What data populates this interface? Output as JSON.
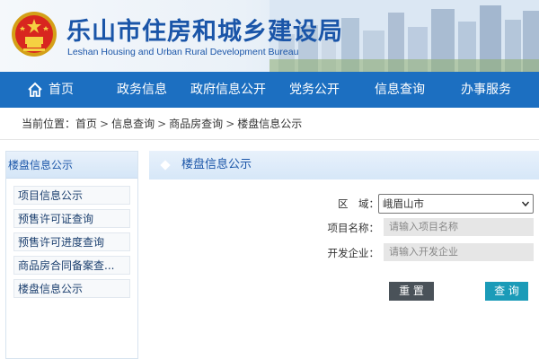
{
  "header": {
    "title": "乐山市住房和城乡建设局",
    "subtitle": "Leshan Housing and Urban Rural Development Bureau",
    "emblem_icon": "national-emblem-icon"
  },
  "nav": {
    "home": "首页",
    "items": [
      "政务信息",
      "政府信息公开",
      "党务公开",
      "信息查询",
      "办事服务"
    ]
  },
  "breadcrumb": {
    "label": "当前位置：",
    "items": [
      "首页",
      "信息查询",
      "商品房查询",
      "楼盘信息公示"
    ],
    "separator": ">"
  },
  "sidebar": {
    "title": "楼盘信息公示",
    "items": [
      "项目信息公示",
      "预售许可证查询",
      "预售许可进度查询",
      "商品房合同备案查...",
      "楼盘信息公示"
    ]
  },
  "panel": {
    "title": "楼盘信息公示",
    "form": {
      "region_label": "区　域：",
      "region_value": "峨眉山市",
      "project_label": "项目名称：",
      "project_placeholder": "请输入项目名称",
      "developer_label": "开发企业：",
      "developer_placeholder": "请输入开发企业"
    },
    "reset_label": "重 置",
    "query_label": "查 询"
  },
  "colors": {
    "nav_bg": "#1c6fc1",
    "title_blue": "#1a55a8",
    "reset_btn": "#4a5259",
    "query_btn": "#1b9bb8"
  }
}
